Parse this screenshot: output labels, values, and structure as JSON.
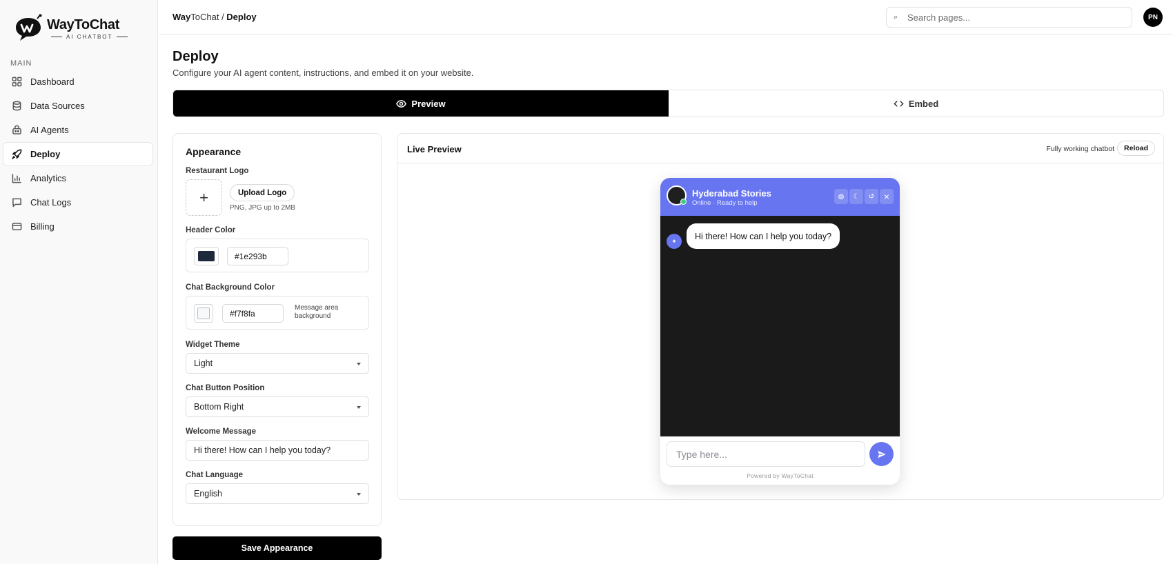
{
  "brand": {
    "name": "WayToChat",
    "tagline": "AI CHATBOT"
  },
  "sidebar": {
    "heading": "MAIN",
    "items": [
      {
        "label": "Dashboard",
        "icon": "grid-icon"
      },
      {
        "label": "Data Sources",
        "icon": "database-icon"
      },
      {
        "label": "AI Agents",
        "icon": "bot-icon"
      },
      {
        "label": "Deploy",
        "icon": "rocket-icon",
        "active": true
      },
      {
        "label": "Analytics",
        "icon": "bar-chart-icon"
      },
      {
        "label": "Chat Logs",
        "icon": "message-icon"
      },
      {
        "label": "Billing",
        "icon": "credit-card-icon"
      }
    ]
  },
  "topbar": {
    "breadcrumb": {
      "root_bold": "Way",
      "root_rest": "ToChat",
      "separator": " / ",
      "current": "Deploy"
    },
    "search_placeholder": "Search pages...",
    "avatar_initials": "PN"
  },
  "page": {
    "title": "Deploy",
    "subtitle": "Configure your AI agent content, instructions, and embed it on your website."
  },
  "tabs": [
    {
      "label": "Preview",
      "icon": "eye-icon",
      "active": true
    },
    {
      "label": "Embed",
      "icon": "code-icon",
      "active": false
    }
  ],
  "appearance": {
    "title": "Appearance",
    "logo_label": "Restaurant Logo",
    "upload_label": "Upload Logo",
    "upload_hint": "PNG, JPG up to 2MB",
    "header_color_label": "Header Color",
    "header_color_value": "#1e293b",
    "chat_bg_label": "Chat Background Color",
    "chat_bg_value": "#f7f8fa",
    "chat_bg_note": "Message area background",
    "theme_label": "Widget Theme",
    "theme_value": "Light",
    "position_label": "Chat Button Position",
    "position_value": "Bottom Right",
    "welcome_label": "Welcome Message",
    "welcome_value": "Hi there! How can I help you today?",
    "language_label": "Chat Language",
    "language_value": "English",
    "save_label": "Save Appearance"
  },
  "live_preview": {
    "title": "Live Preview",
    "note": "Fully working chatbot",
    "reload_label": "Reload",
    "widget": {
      "name": "Hyderabad Stories",
      "status": "Online · Ready to help",
      "greeting": "Hi there! How can I help you today?",
      "input_placeholder": "Type here...",
      "powered_by": "Powered by WayToChat",
      "controls": [
        "globe-icon",
        "moon-icon",
        "refresh-icon",
        "close-icon"
      ],
      "accent_color": "#6776f0"
    }
  },
  "colors": {
    "accent": "#6776f0",
    "primary": "#000000",
    "widget_body": "#1a1a1a"
  }
}
